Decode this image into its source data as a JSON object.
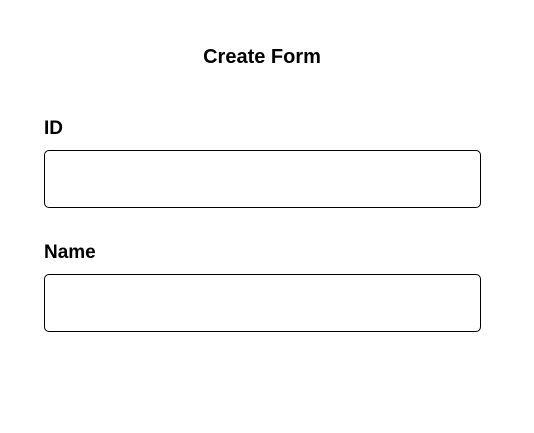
{
  "form": {
    "title": "Create Form",
    "fields": [
      {
        "label": "ID",
        "value": "",
        "placeholder": ""
      },
      {
        "label": "Name",
        "value": "",
        "placeholder": ""
      }
    ]
  }
}
